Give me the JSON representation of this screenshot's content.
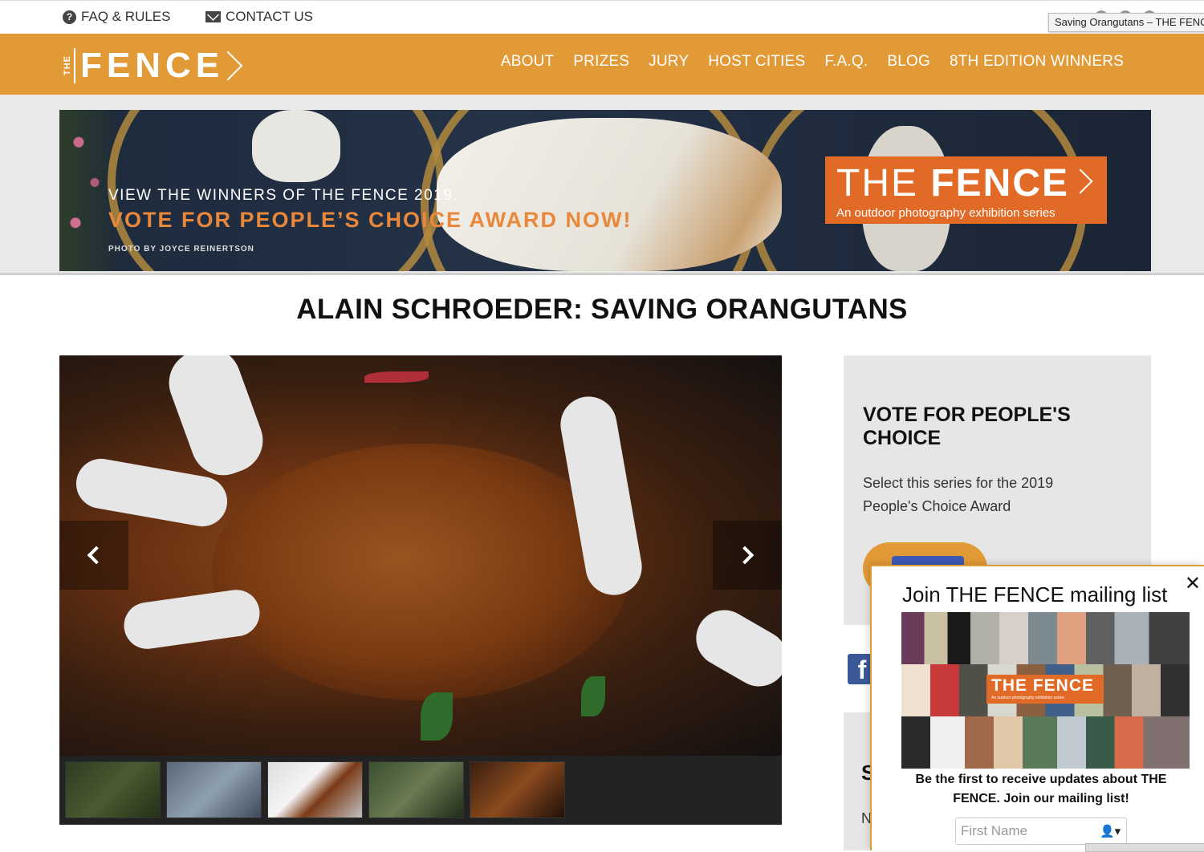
{
  "utility": {
    "faq": "FAQ & RULES",
    "contact": "CONTACT US",
    "tooltip": "Saving Orangutans – THE FENCE"
  },
  "nav": {
    "logo_small": "THE",
    "logo_word": "FENCE",
    "links": [
      "ABOUT",
      "PRIZES",
      "JURY",
      "HOST CITIES",
      "F.A.Q.",
      "BLOG",
      "8TH EDITION WINNERS"
    ]
  },
  "banner": {
    "line1": "VIEW THE WINNERS OF THE FENCE 2019.",
    "line2": "VOTE FOR PEOPLE’S CHOICE AWARD NOW!",
    "credit": "PHOTO BY JOYCE REINERTSON",
    "badge_the": "THE",
    "badge_fence": "FENCE",
    "badge_sub": "An outdoor photography exhibition series"
  },
  "page": {
    "title": "ALAIN SCHROEDER: SAVING ORANGUTANS"
  },
  "sidebar": {
    "vote_heading": "VOTE FOR PEOPLE'S CHOICE",
    "vote_text": "Select this series for the 2019 People's Choice Award",
    "fb_letter": "f",
    "box2_initial": "S",
    "box2_text": "N"
  },
  "popup": {
    "title": "Join THE FENCE mailing list",
    "close": "✕",
    "collage_title": "THE FENCE",
    "collage_sub": "An outdoor photography exhibition series",
    "description": "Be the first to receive updates about THE FENCE. Join our mailing list!",
    "first_name_placeholder": "First Name",
    "person_icon": "👤▾"
  },
  "colors": {
    "brand_orange": "#e29a37",
    "badge_orange": "#e26a27",
    "facebook_blue": "#3b5998"
  }
}
